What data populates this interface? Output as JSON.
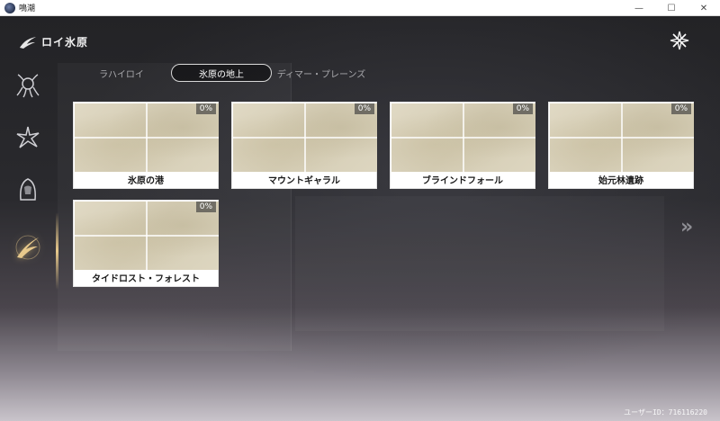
{
  "window": {
    "title": "鳴潮",
    "minimize": "—",
    "maximize": "☐",
    "close": "✕"
  },
  "region": {
    "title": "ロイ氷原",
    "emblem": "wing-emblem-icon"
  },
  "sidebar": {
    "items": [
      {
        "icon": "tentacle-creature-icon",
        "active": false
      },
      {
        "icon": "star-burst-creature-icon",
        "active": false
      },
      {
        "icon": "hooded-figure-icon",
        "active": false
      },
      {
        "icon": "wing-emblem-icon",
        "active": true
      }
    ]
  },
  "tabs": [
    {
      "label": "ラハイロイ",
      "active": false
    },
    {
      "label": "氷原の地上",
      "active": true
    },
    {
      "label": "ディマー・プレーンズ",
      "active": false
    }
  ],
  "cards": [
    {
      "label": "氷原の港",
      "progress": "0%"
    },
    {
      "label": "マウントギャラル",
      "progress": "0%"
    },
    {
      "label": "ブラインドフォール",
      "progress": "0%"
    },
    {
      "label": "始元林遺跡",
      "progress": "0%"
    },
    {
      "label": "タイドロスト・フォレスト",
      "progress": "0%"
    }
  ],
  "next_arrow": "»",
  "uid": "ユーザーID：716116220"
}
